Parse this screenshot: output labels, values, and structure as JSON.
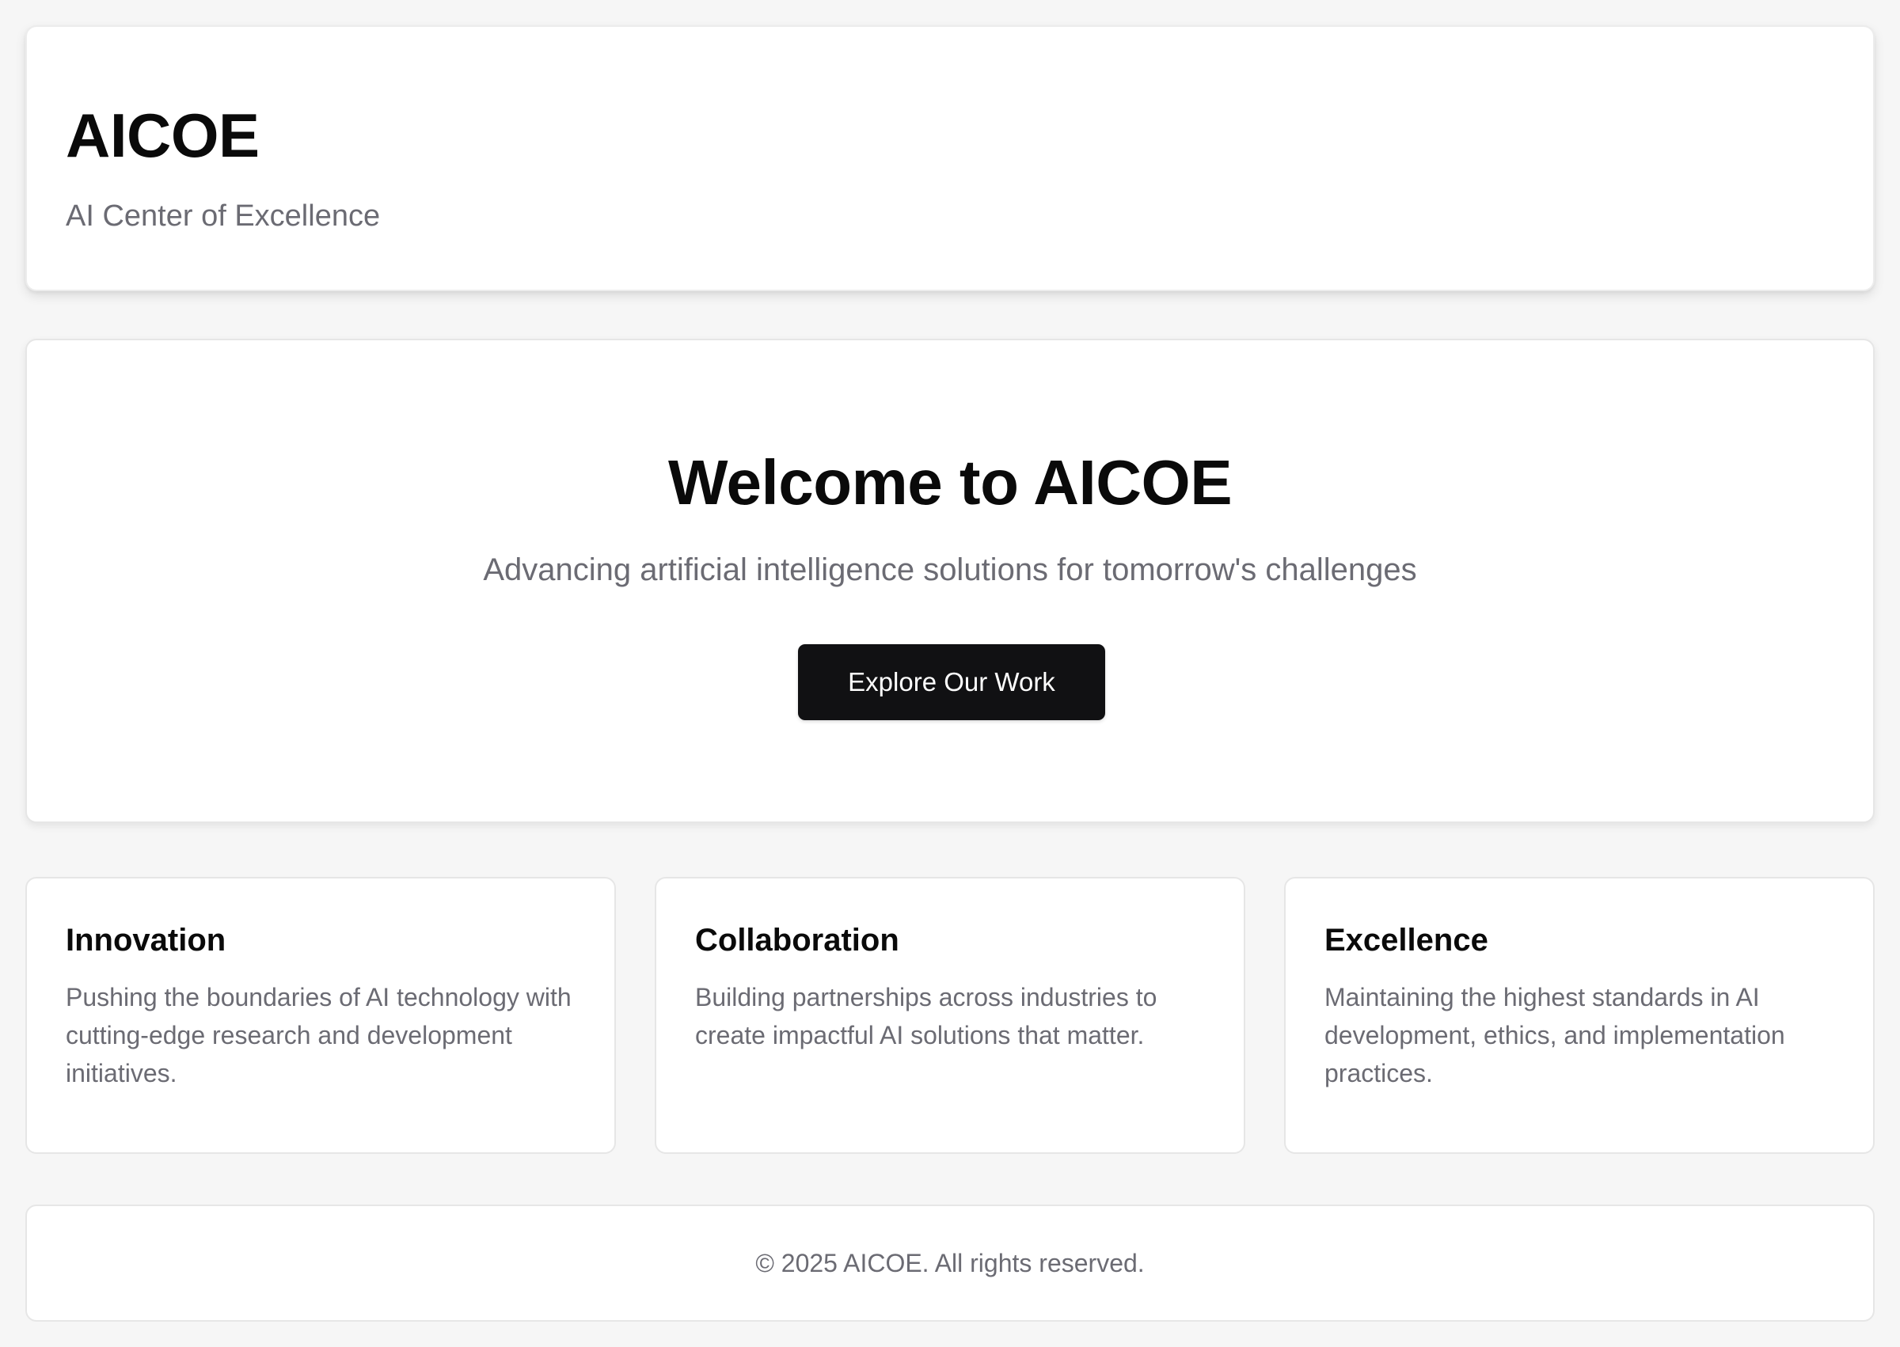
{
  "header": {
    "title": "AICOE",
    "subtitle": "AI Center of Excellence"
  },
  "hero": {
    "title": "Welcome to AICOE",
    "subtitle": "Advancing artificial intelligence solutions for tomorrow's challenges",
    "button_label": "Explore Our Work"
  },
  "features": [
    {
      "title": "Innovation",
      "description": "Pushing the boundaries of AI technology with cutting-edge research and development initiatives."
    },
    {
      "title": "Collaboration",
      "description": "Building partnerships across industries to create impactful AI solutions that matter."
    },
    {
      "title": "Excellence",
      "description": "Maintaining the highest standards in AI development, ethics, and implementation practices."
    }
  ],
  "footer": {
    "text": "© 2025 AICOE. All rights reserved."
  },
  "colors": {
    "background": "#f6f6f6",
    "card": "#ffffff",
    "primary_button": "#111113",
    "muted_text": "#6b6b73"
  }
}
